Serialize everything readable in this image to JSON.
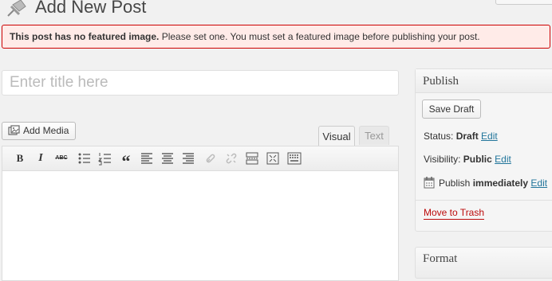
{
  "header": {
    "title": "Add New Post"
  },
  "notice": {
    "bold": "This post has no featured image.",
    "text": " Please set one. You must set a featured image before publishing your post."
  },
  "title_field": {
    "placeholder": "Enter title here"
  },
  "media": {
    "add_media_label": "Add Media"
  },
  "editor_tabs": {
    "visual": "Visual",
    "text": "Text"
  },
  "toolbar": {
    "bold": "B",
    "italic": "I",
    "strikethrough": "ABC",
    "quote": "“",
    "icons": [
      "bold-icon",
      "italic-icon",
      "strikethrough-icon",
      "bulleted-list-icon",
      "numbered-list-icon",
      "blockquote-icon",
      "align-left-icon",
      "align-center-icon",
      "align-right-icon",
      "link-icon",
      "unlink-icon",
      "insert-more-icon",
      "fullscreen-icon",
      "toolbar-toggle-icon"
    ]
  },
  "publish": {
    "title": "Publish",
    "save_draft": "Save Draft",
    "status_label": "Status: ",
    "status_value": "Draft",
    "visibility_label": "Visibility: ",
    "visibility_value": "Public",
    "schedule_label": "Publish ",
    "schedule_value": "immediately",
    "edit": "Edit",
    "trash": "Move to Trash"
  },
  "format": {
    "title": "Format"
  },
  "colors": {
    "notice_bg": "#ffebe8",
    "notice_border": "#cc0000",
    "link": "#21759b",
    "trash": "#bc0b0b"
  }
}
